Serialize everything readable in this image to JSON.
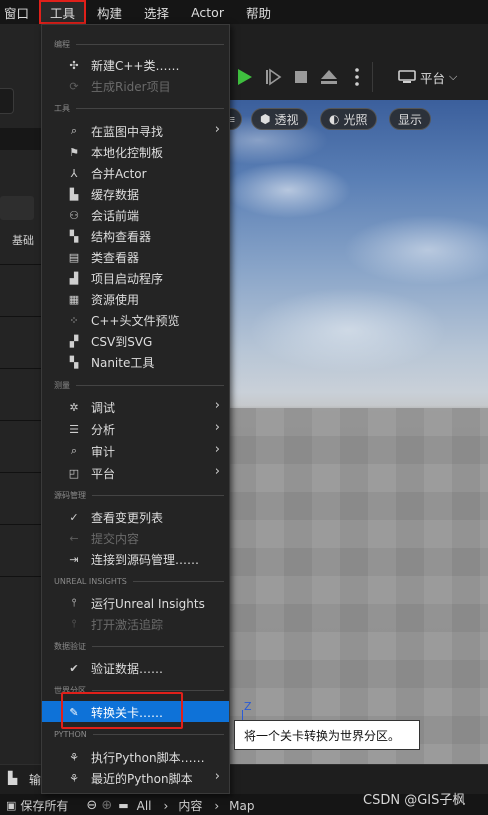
{
  "menubar": {
    "items": [
      {
        "label": "窗口"
      },
      {
        "label": "工具"
      },
      {
        "label": "构建"
      },
      {
        "label": "选择"
      },
      {
        "label": "Actor"
      },
      {
        "label": "帮助"
      }
    ],
    "active_index": 1
  },
  "left_panel": {
    "label": "基础"
  },
  "toolbar": {
    "platform_label": "平台",
    "play_color": "#3fbf3f"
  },
  "viewport": {
    "buttons": [
      {
        "label": "透视",
        "icon": "cube-icon"
      },
      {
        "label": "光照",
        "icon": "sun-icon"
      },
      {
        "label": "显示",
        "icon": ""
      }
    ],
    "gizmo_label": "Z"
  },
  "dropdown": {
    "sections": [
      {
        "title": "编程",
        "items": [
          {
            "label": "新建C++类……",
            "icon": "class-icon",
            "disabled": false,
            "submenu": false
          },
          {
            "label": "生成Rider项目",
            "icon": "refresh-icon",
            "disabled": true,
            "submenu": false
          }
        ]
      },
      {
        "title": "工具",
        "items": [
          {
            "label": "在蓝图中寻找",
            "icon": "search-icon",
            "disabled": false,
            "submenu": true
          },
          {
            "label": "本地化控制板",
            "icon": "flag-icon",
            "disabled": false,
            "submenu": false
          },
          {
            "label": "合并Actor",
            "icon": "merge-icon",
            "disabled": false,
            "submenu": false
          },
          {
            "label": "缓存数据",
            "icon": "bar-chart-icon",
            "disabled": false,
            "submenu": false
          },
          {
            "label": "会话前端",
            "icon": "session-icon",
            "disabled": false,
            "submenu": false
          },
          {
            "label": "结构查看器",
            "icon": "struct-icon",
            "disabled": false,
            "submenu": false
          },
          {
            "label": "类查看器",
            "icon": "class-viewer-icon",
            "disabled": false,
            "submenu": false
          },
          {
            "label": "项目启动程序",
            "icon": "launcher-icon",
            "disabled": false,
            "submenu": false
          },
          {
            "label": "资源使用",
            "icon": "table-icon",
            "disabled": false,
            "submenu": false
          },
          {
            "label": "C++头文件预览",
            "icon": "header-preview-icon",
            "disabled": false,
            "submenu": false
          },
          {
            "label": "CSV到SVG",
            "icon": "csv-icon",
            "disabled": false,
            "submenu": false
          },
          {
            "label": "Nanite工具",
            "icon": "nanite-icon",
            "disabled": false,
            "submenu": false
          }
        ]
      },
      {
        "title": "测量",
        "items": [
          {
            "label": "调试",
            "icon": "bug-icon",
            "disabled": false,
            "submenu": true
          },
          {
            "label": "分析",
            "icon": "analyze-icon",
            "disabled": false,
            "submenu": true
          },
          {
            "label": "审计",
            "icon": "audit-icon",
            "disabled": false,
            "submenu": true
          },
          {
            "label": "平台",
            "icon": "platform-icon",
            "disabled": false,
            "submenu": true
          }
        ]
      },
      {
        "title": "源码管理",
        "items": [
          {
            "label": "查看变更列表",
            "icon": "check-circle-icon",
            "disabled": false,
            "submenu": false
          },
          {
            "label": "提交内容",
            "icon": "arrow-left-icon",
            "disabled": true,
            "submenu": false
          },
          {
            "label": "连接到源码管理……",
            "icon": "connect-icon",
            "disabled": false,
            "submenu": false
          }
        ]
      },
      {
        "title": "UNREAL INSIGHTS",
        "items": [
          {
            "label": "运行Unreal Insights",
            "icon": "insights-icon",
            "disabled": false,
            "submenu": false
          },
          {
            "label": "打开激活追踪",
            "icon": "trace-icon",
            "disabled": true,
            "submenu": false
          }
        ]
      },
      {
        "title": "数据验证",
        "items": [
          {
            "label": "验证数据……",
            "icon": "validate-icon",
            "disabled": false,
            "submenu": false
          }
        ]
      },
      {
        "title": "世界分区",
        "items": [
          {
            "label": "转换关卡……",
            "icon": "convert-icon",
            "disabled": false,
            "submenu": false,
            "selected": true
          }
        ]
      },
      {
        "title": "PYTHON",
        "items": [
          {
            "label": "执行Python脚本……",
            "icon": "python-icon",
            "disabled": false,
            "submenu": false
          },
          {
            "label": "最近的Python脚本",
            "icon": "python-icon",
            "disabled": false,
            "submenu": true
          }
        ]
      }
    ]
  },
  "tooltip": {
    "text": "将一个关卡转换为世界分区。"
  },
  "bottom": {
    "output_label": "输",
    "save_all": "保存所有",
    "breadcrumb": [
      "All",
      "内容",
      "Map"
    ]
  },
  "watermark": "CSDN @GIS子枫",
  "colors": {
    "accent": "#0e72d8",
    "highlight_red": "#e0201a"
  }
}
